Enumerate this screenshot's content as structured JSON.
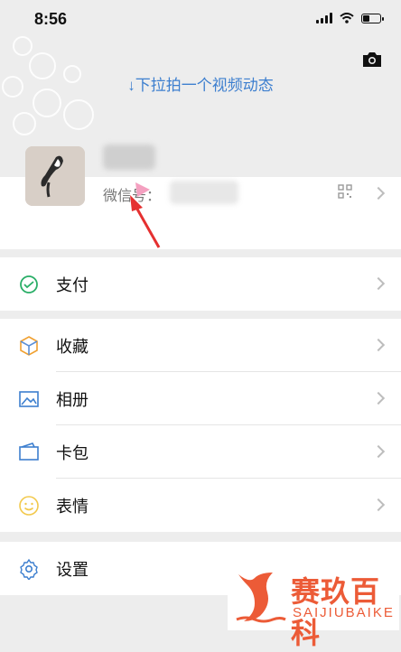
{
  "status_bar": {
    "time": "8:56",
    "battery_level": 0.35
  },
  "header": {
    "pull_hint": "↓下拉拍一个视频动态"
  },
  "profile": {
    "wechat_id_label": "微信号："
  },
  "menu_sections": [
    {
      "items": [
        {
          "label": "支付",
          "icon": "wechat-pay-icon",
          "color": "#2aae67"
        }
      ]
    },
    {
      "items": [
        {
          "label": "收藏",
          "icon": "favorites-cube-icon",
          "color": "#f0a030"
        },
        {
          "label": "相册",
          "icon": "album-icon",
          "color": "#3d7fcf"
        },
        {
          "label": "卡包",
          "icon": "card-wallet-icon",
          "color": "#3d7fcf"
        },
        {
          "label": "表情",
          "icon": "emoji-face-icon",
          "color": "#f2c94c"
        }
      ]
    },
    {
      "items": [
        {
          "label": "设置",
          "icon": "gear-icon",
          "color": "#3d7fcf"
        }
      ]
    }
  ],
  "watermark": {
    "title": "赛玖百科",
    "subtitle": "SAIJIUBAIKE",
    "color": "#ec5b37"
  },
  "colors": {
    "background": "#ededed",
    "accent_blue": "#3d7fcf",
    "annotation_red": "#e53030"
  }
}
